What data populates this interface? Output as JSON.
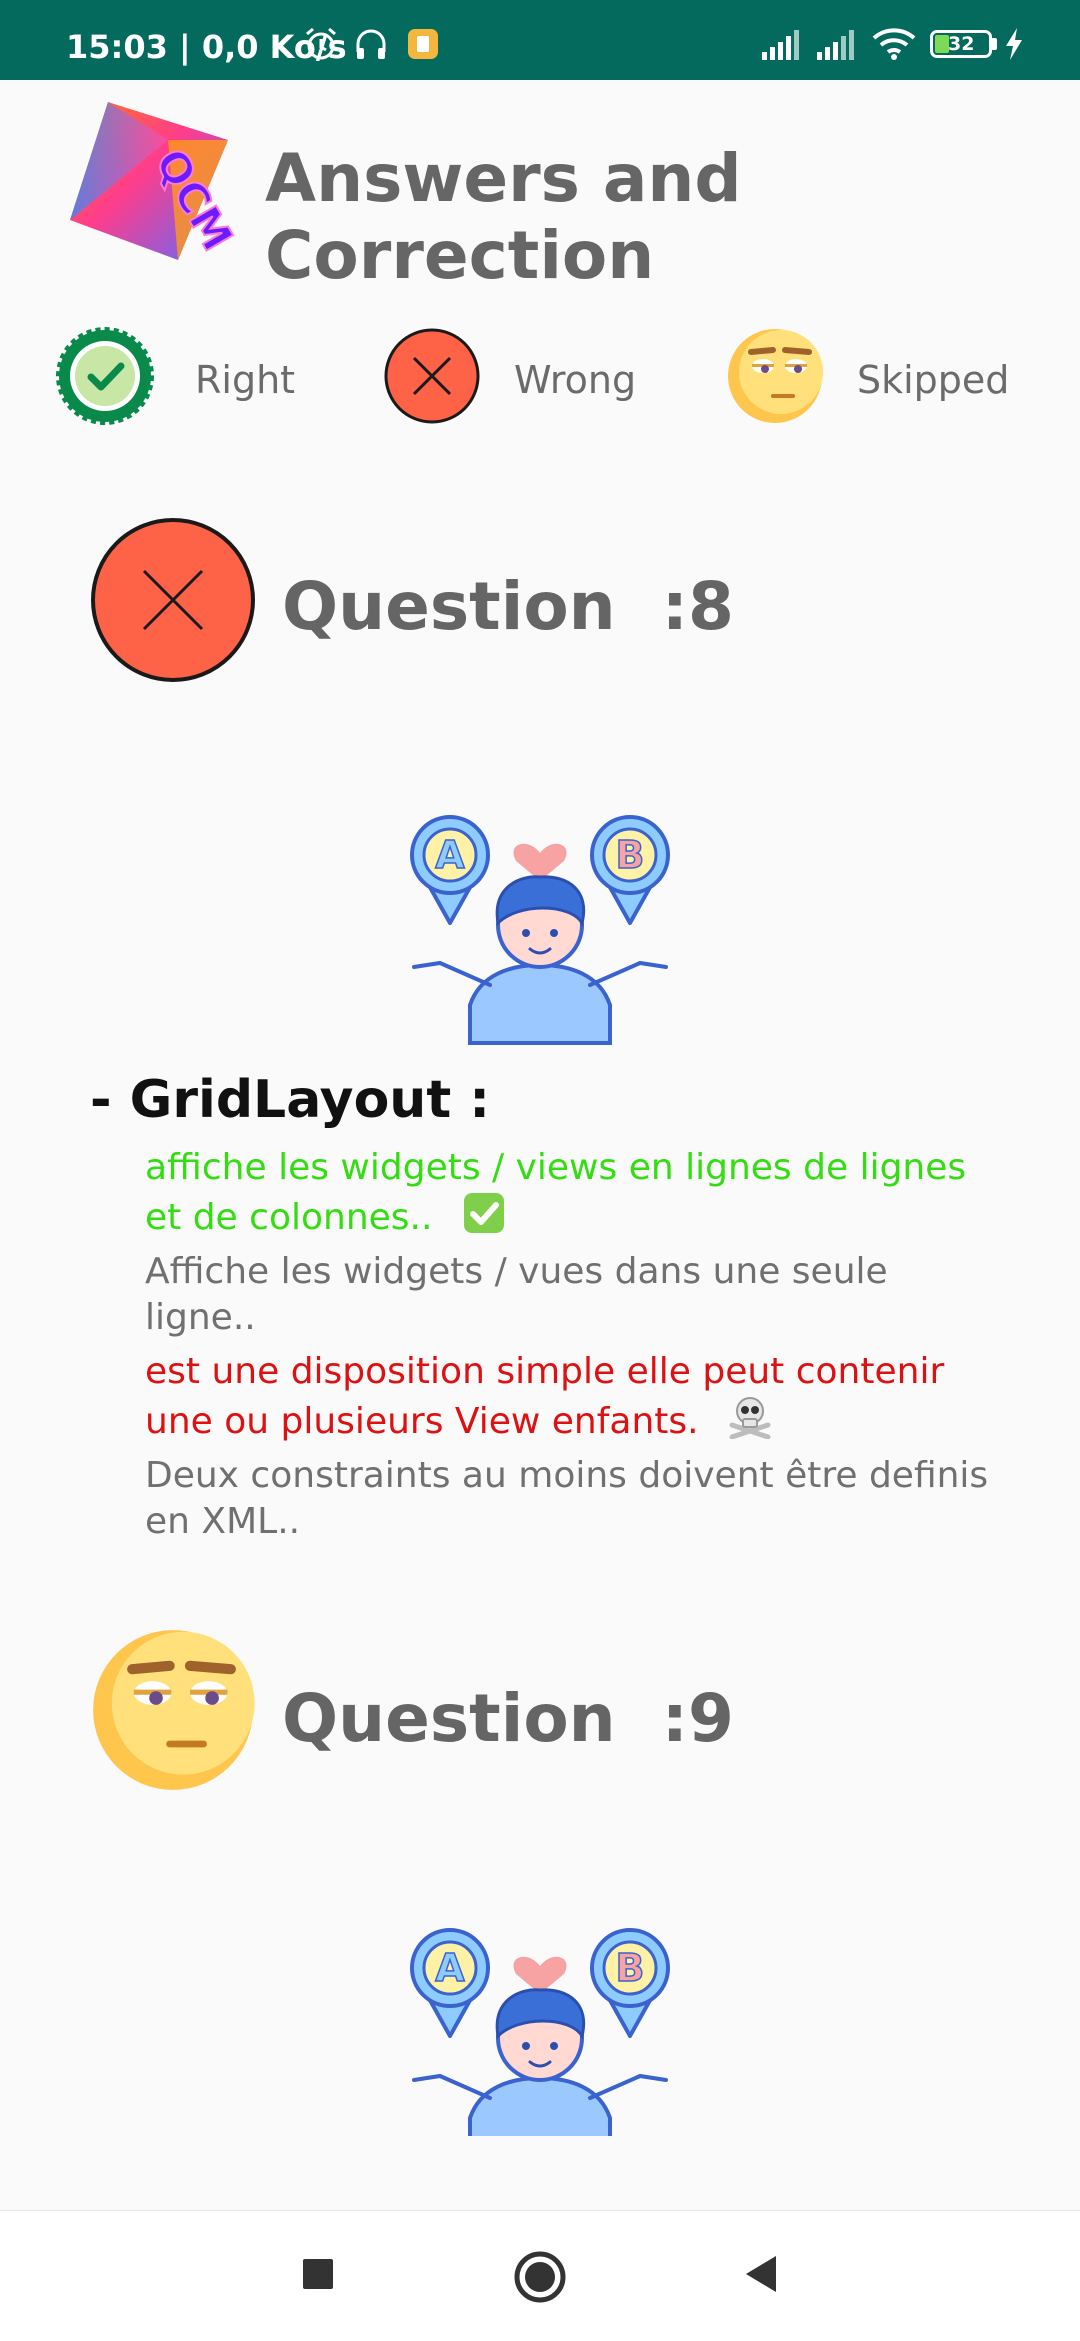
{
  "status_bar": {
    "time_speed": "15:03 | 0,0 Ko/s",
    "battery": "32"
  },
  "header": {
    "logo_text": "QCM",
    "title": "Answers and Correction"
  },
  "legend": {
    "right": "Right",
    "wrong": "Wrong",
    "skipped": "Skipped"
  },
  "questions": [
    {
      "status": "wrong",
      "title": "Question  :8",
      "illustration_letters": [
        "A",
        "B"
      ],
      "topic": "- GridLayout :",
      "answers": [
        {
          "text": "affiche les widgets / views en lignes de lignes et de colonnes..",
          "state": "correct"
        },
        {
          "text": "Affiche les widgets / vues dans une seule ligne..",
          "state": "neutral"
        },
        {
          "text": "est une disposition simple elle peut contenir une ou plusieurs View enfants.",
          "state": "wrong"
        },
        {
          "text": "Deux constraints au moins doivent être definis en XML..",
          "state": "neutral"
        }
      ]
    },
    {
      "status": "skipped",
      "title": "Question  :9",
      "illustration_letters": [
        "A",
        "B"
      ]
    }
  ],
  "colors": {
    "status_bar": "#046a5e",
    "correct": "#33dd11",
    "wrong": "#dd1111",
    "wrong_icon": "#ff6347",
    "neutral": "#707070"
  },
  "icons": {
    "right": "check-badge-icon",
    "wrong": "x-circle-icon",
    "skipped": "unamused-face-icon",
    "correct_mark": "check-mark-button-icon",
    "wrong_mark": "skull-crossbones-icon"
  }
}
